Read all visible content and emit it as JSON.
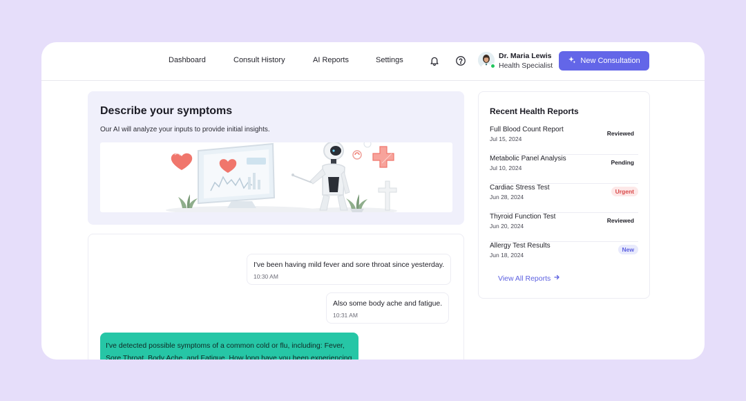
{
  "nav": {
    "items": [
      {
        "label": "Dashboard"
      },
      {
        "label": "Consult History"
      },
      {
        "label": "AI Reports"
      },
      {
        "label": "Settings"
      }
    ]
  },
  "header": {
    "icons": [
      "bell-icon",
      "help-circle-icon"
    ],
    "user": {
      "name": "Dr. Maria Lewis",
      "role": "Health Specialist",
      "status": "online"
    },
    "new_button_label": "New Consultation",
    "accent_color": "#6366e8"
  },
  "symptoms": {
    "title": "Describe your symptoms",
    "subtitle": "Our AI will analyze your inputs to provide initial insights."
  },
  "chat": {
    "messages": [
      {
        "from": "user",
        "text": "I've been having mild fever and sore throat since yesterday.",
        "time": "10:30 AM"
      },
      {
        "from": "user",
        "text": "Also some body ache and fatigue.",
        "time": "10:31 AM"
      },
      {
        "from": "ai",
        "text": "I've detected possible symptoms of a common cold or flu, including: Fever, Sore Throat, Body Ache, and Fatigue. How long have you been experiencing"
      }
    ],
    "ai_color": "#26c6a6"
  },
  "reports": {
    "title": "Recent Health Reports",
    "items": [
      {
        "name": "Full Blood Count Report",
        "date": "Jul 15, 2024",
        "status": "Reviewed",
        "badge_bg": "#ffffff",
        "badge_fg": "#1e1e26"
      },
      {
        "name": "Metabolic Panel Analysis",
        "date": "Jul 10, 2024",
        "status": "Pending",
        "badge_bg": "#ffffff",
        "badge_fg": "#1e1e26"
      },
      {
        "name": "Cardiac Stress Test",
        "date": "Jun 28, 2024",
        "status": "Urgent",
        "badge_bg": "#fde8e8",
        "badge_fg": "#d94a4a"
      },
      {
        "name": "Thyroid Function Test",
        "date": "Jun 20, 2024",
        "status": "Reviewed",
        "badge_bg": "#ffffff",
        "badge_fg": "#1e1e26"
      },
      {
        "name": "Allergy Test Results",
        "date": "Jun 18, 2024",
        "status": "New",
        "badge_bg": "#e8eafc",
        "badge_fg": "#5b5fe0"
      }
    ],
    "view_all_label": "View All Reports"
  }
}
